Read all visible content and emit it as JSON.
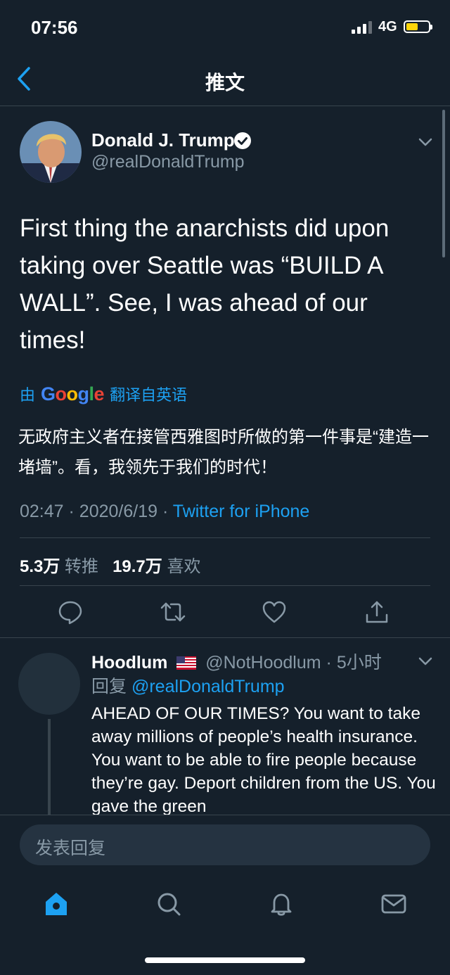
{
  "status_bar": {
    "time": "07:56",
    "network": "4G",
    "battery_level": 0.45
  },
  "nav": {
    "title": "推文"
  },
  "tweet": {
    "author_name": "Donald J. Trump",
    "handle": "@realDonaldTrump",
    "text": "First thing the anarchists did upon taking over Seattle was “BUILD A WALL”. See, I was ahead of our times!",
    "translation_prefix": "由",
    "translation_brand": "Google",
    "translation_suffix": "翻译自英语",
    "translated_text": "无政府主义者在接管西雅图时所做的第一件事是“建造一堵墙”。看，我领先于我们的时代！",
    "time": "02:47",
    "date": "2020/6/19",
    "source": "Twitter for iPhone",
    "retweets": "5.3万",
    "retweets_label": "转推",
    "likes": "19.7万",
    "likes_label": "喜欢"
  },
  "reply": {
    "name": "Hoodlum",
    "handle": "@NotHoodlum",
    "time": "5小时",
    "reply_label": "回复",
    "reply_to": "@realDonaldTrump",
    "text": "AHEAD OF OUR TIMES? You want to take away millions of people’s health insurance. You want to be able to fire people because they’re gay. Deport children from the US. You gave the green"
  },
  "composer": {
    "placeholder": "发表回复"
  },
  "icons": {
    "back": "chevron-left-icon",
    "verified": "verified-badge-icon",
    "more": "chevron-down-icon",
    "reply": "comment-icon",
    "retweet": "retweet-icon",
    "like": "heart-icon",
    "share": "share-icon",
    "home": "home-icon",
    "search": "search-icon",
    "notifications": "bell-icon",
    "messages": "mail-icon"
  },
  "colors": {
    "background": "#15202b",
    "accent": "#1da1f2",
    "secondary_text": "#8899a6",
    "divider": "#38444d"
  }
}
